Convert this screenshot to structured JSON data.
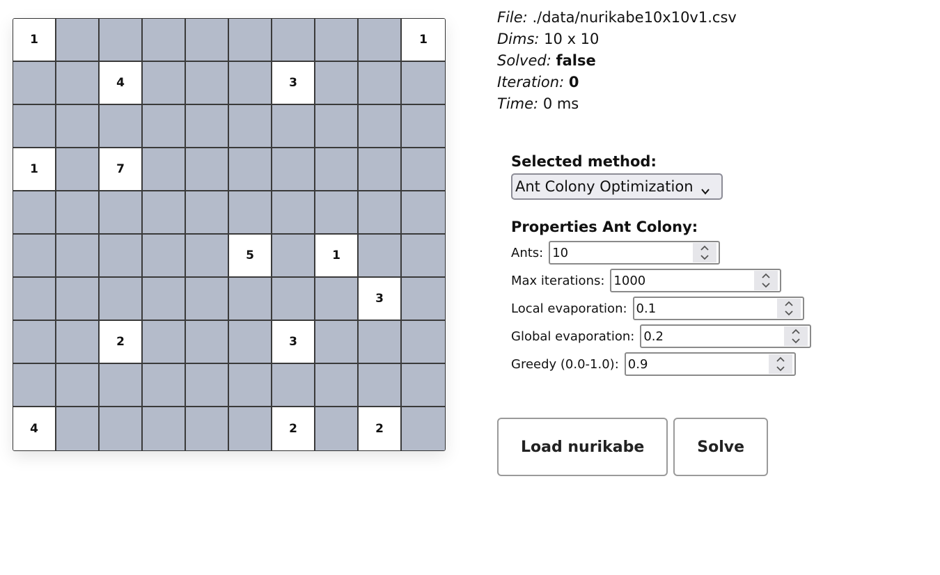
{
  "board": {
    "rows": 10,
    "cols": 10,
    "cells": [
      [
        "1",
        "",
        "",
        "",
        "",
        "",
        "",
        "",
        "",
        "1"
      ],
      [
        "",
        "",
        "4",
        "",
        "",
        "",
        "3",
        "",
        "",
        ""
      ],
      [
        "",
        "",
        "",
        "",
        "",
        "",
        "",
        "",
        "",
        ""
      ],
      [
        "1",
        "",
        "7",
        "",
        "",
        "",
        "",
        "",
        "",
        ""
      ],
      [
        "",
        "",
        "",
        "",
        "",
        "",
        "",
        "",
        "",
        ""
      ],
      [
        "",
        "",
        "",
        "",
        "",
        "5",
        "",
        "1",
        "",
        ""
      ],
      [
        "",
        "",
        "",
        "",
        "",
        "",
        "",
        "",
        "3",
        ""
      ],
      [
        "",
        "",
        "2",
        "",
        "",
        "",
        "3",
        "",
        "",
        ""
      ],
      [
        "",
        "",
        "",
        "",
        "",
        "",
        "",
        "",
        "",
        ""
      ],
      [
        "4",
        "",
        "",
        "",
        "",
        "",
        "2",
        "",
        "2",
        ""
      ]
    ],
    "colors": {
      "numbered": "#ffffff",
      "unknown": "#b4bbca",
      "grid": "#3a3a3a"
    }
  },
  "info": {
    "file_label": "File:",
    "file_value": "./data/nurikabe10x10v1.csv",
    "dims_label": "Dims:",
    "dims_value": "10 x 10",
    "solved_label": "Solved:",
    "solved_value": "false",
    "iteration_label": "Iteration:",
    "iteration_value": "0",
    "time_label": "Time:",
    "time_value": "0 ms"
  },
  "method": {
    "heading": "Selected method:",
    "selected": "Ant Colony Optimization"
  },
  "properties": {
    "heading": "Properties Ant Colony:",
    "fields": [
      {
        "label": "Ants:",
        "value": "10"
      },
      {
        "label": "Max iterations:",
        "value": "1000"
      },
      {
        "label": "Local evaporation:",
        "value": "0.1"
      },
      {
        "label": "Global evaporation:",
        "value": "0.2"
      },
      {
        "label": "Greedy (0.0-1.0):",
        "value": "0.9"
      }
    ]
  },
  "buttons": {
    "load": "Load nurikabe",
    "solve": "Solve"
  }
}
